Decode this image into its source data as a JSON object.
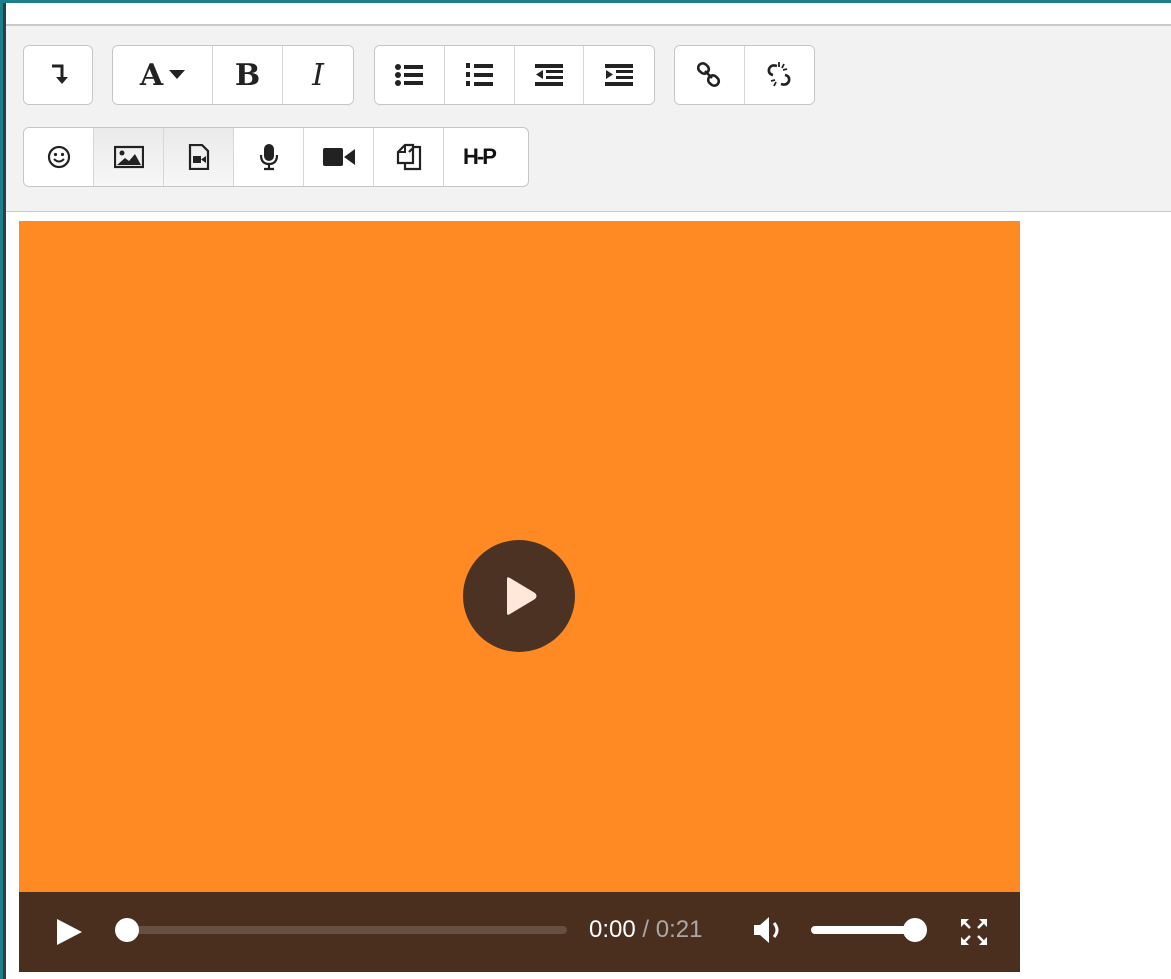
{
  "toolbar": {
    "font_button_label": "A",
    "bold_label": "B",
    "italic_label": "I",
    "h5p_label": "H-P"
  },
  "video": {
    "background_color": "#ff8a24",
    "controls_color": "#4a2f1f",
    "progress_fraction": 0.0,
    "volume_fraction": 1.0,
    "current_time": "0:00",
    "separator": "/",
    "duration": "0:21"
  },
  "icons": {
    "toolbar_row1": [
      "collapse-icon",
      "font-icon",
      "bold-icon",
      "italic-icon",
      "unordered-list-icon",
      "ordered-list-icon",
      "outdent-icon",
      "indent-icon",
      "link-icon",
      "unlink-icon"
    ],
    "toolbar_row2": [
      "emoji-icon",
      "image-icon",
      "media-icon",
      "microphone-icon",
      "video-camera-icon",
      "manage-files-icon",
      "h5p-icon"
    ],
    "player": [
      "big-play-icon",
      "play-icon",
      "volume-icon",
      "fullscreen-icon"
    ]
  }
}
